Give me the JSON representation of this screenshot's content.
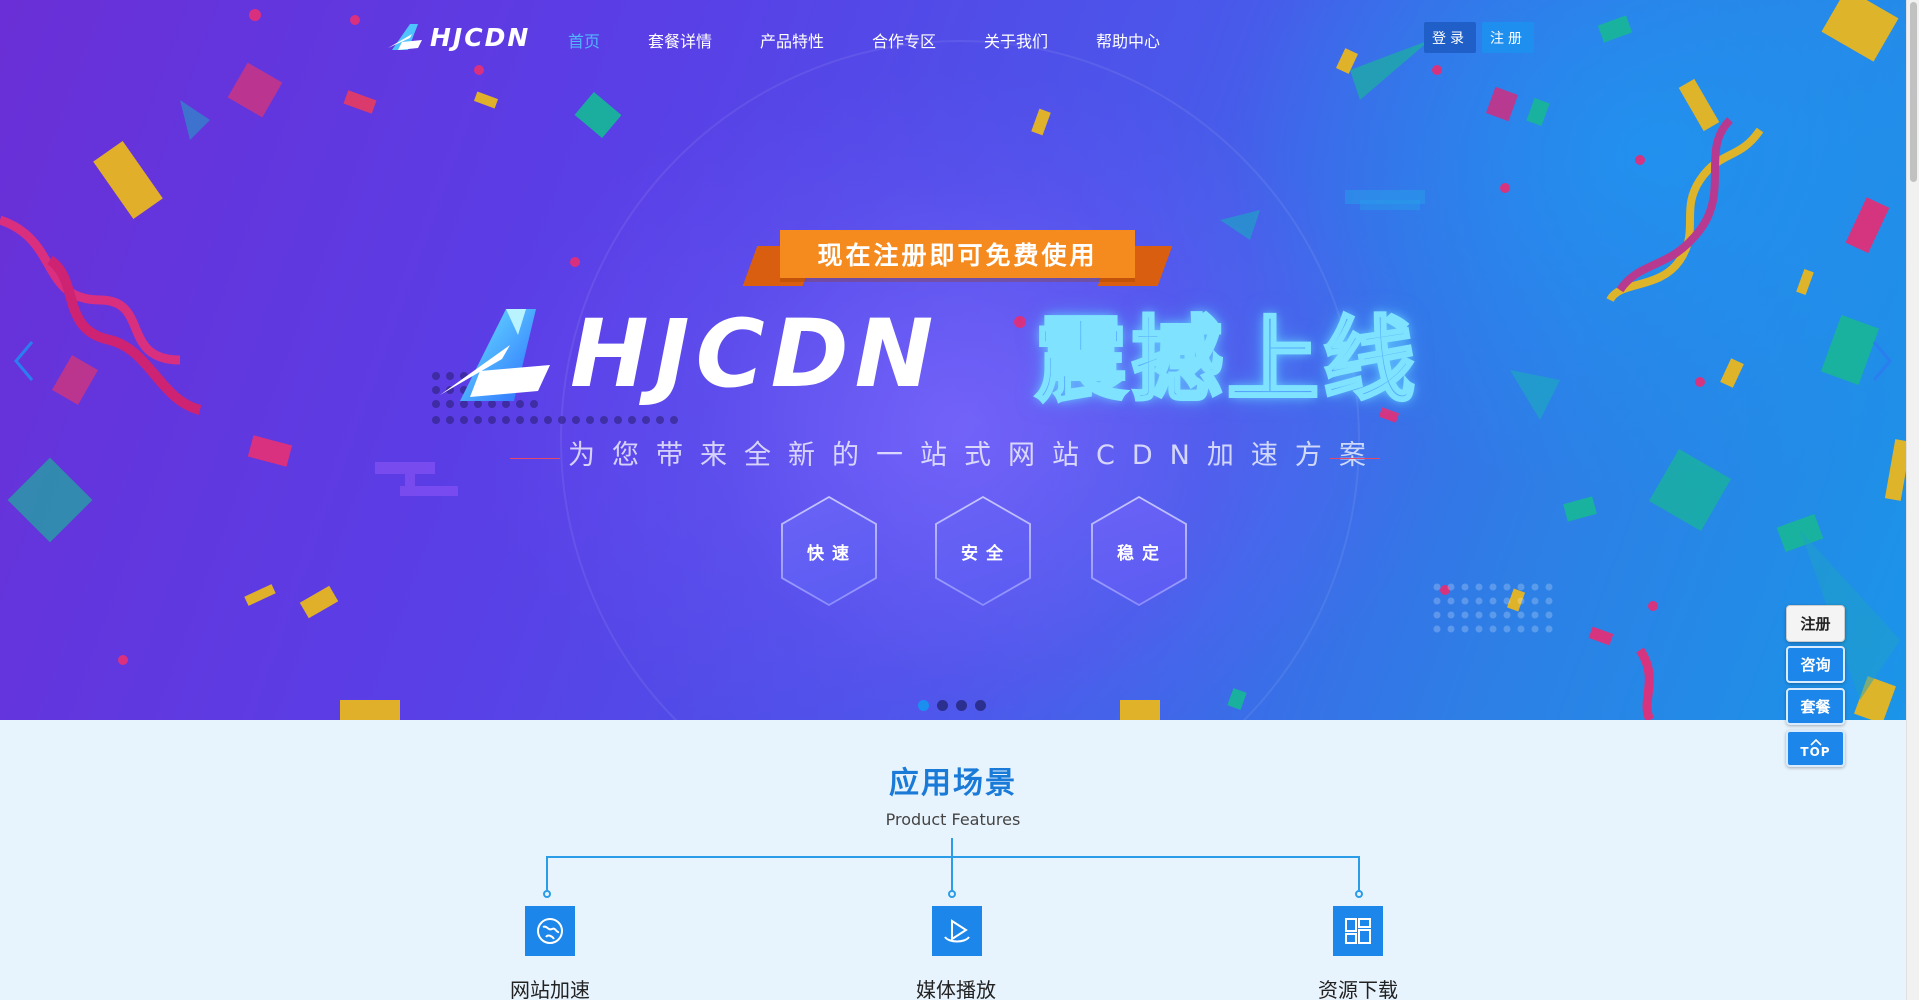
{
  "nav": {
    "logo_text": "HJCDN",
    "items": [
      {
        "label": "首页",
        "active": true
      },
      {
        "label": "套餐详情",
        "active": false
      },
      {
        "label": "产品特性",
        "active": false
      },
      {
        "label": "合作专区",
        "active": false
      },
      {
        "label": "关于我们",
        "active": false
      },
      {
        "label": "帮助中心",
        "active": false
      }
    ],
    "login_label": "登录",
    "register_label": "注册"
  },
  "hero": {
    "ribbon_text": "现在注册即可免费使用",
    "logo_text": "HJCDN",
    "launch_text": "震撼上线",
    "tagline": "为您带来全新的一站式网站CDN加速方案",
    "badges": [
      "快速",
      "安全",
      "稳定"
    ],
    "slides_count": 4,
    "active_slide": 1,
    "prev_icon": "chevron-left-icon",
    "next_icon": "chevron-right-icon"
  },
  "features": {
    "title": "应用场景",
    "subtitle": "Product Features",
    "items": [
      {
        "label": "网站加速",
        "icon": "globe-icon"
      },
      {
        "label": "媒体播放",
        "icon": "play-icon"
      },
      {
        "label": "资源下载",
        "icon": "download-grid-icon"
      }
    ]
  },
  "side": {
    "register": "注册",
    "consult": "咨询",
    "package": "套餐",
    "top": "TOP"
  },
  "colors": {
    "accent": "#1c86ea",
    "nav_active": "#4fb6ff",
    "ribbon": "#f58a1f",
    "section_bg": "#e8f4fd"
  }
}
